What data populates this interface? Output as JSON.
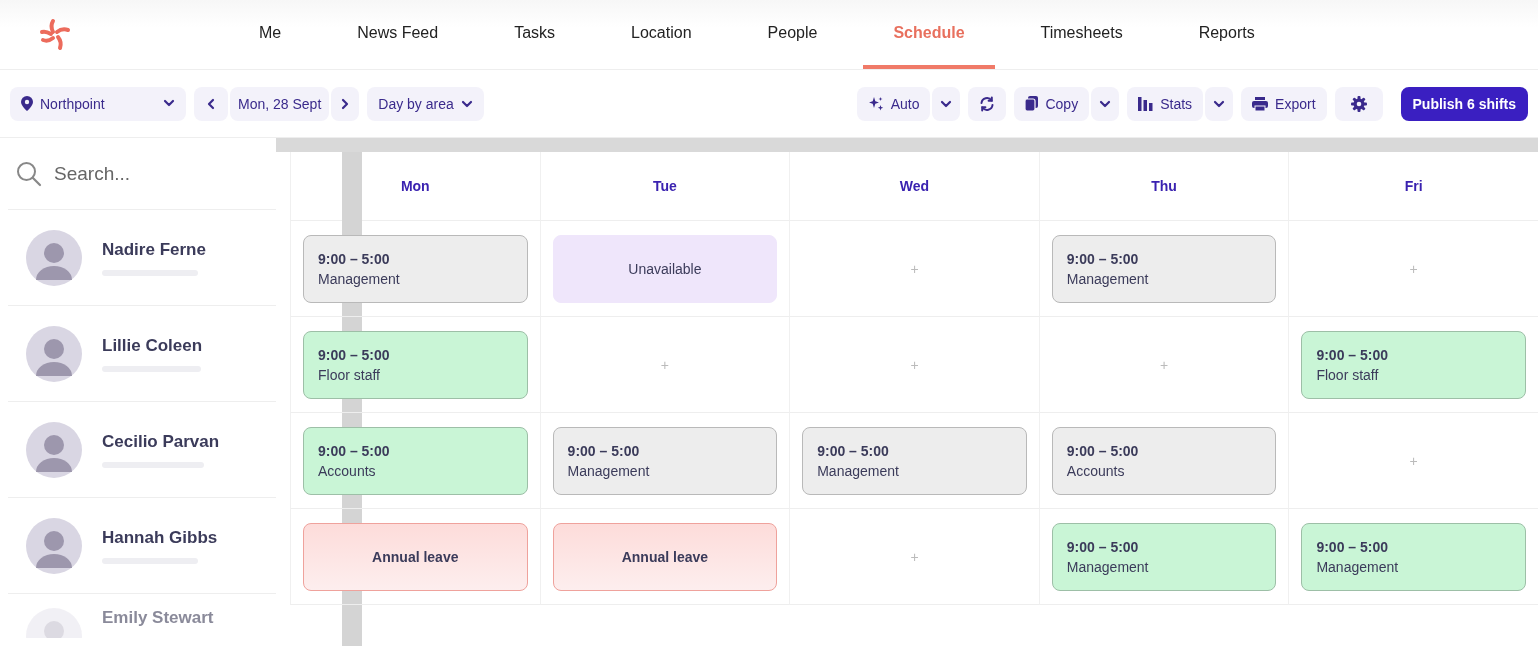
{
  "nav": [
    {
      "label": "Me",
      "selected": false
    },
    {
      "label": "News Feed",
      "selected": false
    },
    {
      "label": "Tasks",
      "selected": false
    },
    {
      "label": "Location",
      "selected": false
    },
    {
      "label": "People",
      "selected": false
    },
    {
      "label": "Schedule",
      "selected": true
    },
    {
      "label": "Timesheets",
      "selected": false
    },
    {
      "label": "Reports",
      "selected": false
    }
  ],
  "toolbar": {
    "location": "Northpoint",
    "date": "Mon, 28 Sept",
    "view": "Day by area",
    "auto": "Auto",
    "copy": "Copy",
    "stats": "Stats",
    "export": "Export",
    "publish": "Publish 6 shifts"
  },
  "search": {
    "placeholder": "Search..."
  },
  "days": [
    "Mon",
    "Tue",
    "Wed",
    "Thu",
    "Fri"
  ],
  "staff": [
    {
      "name": "Nadire Ferne",
      "faded": false,
      "shifts": [
        {
          "kind": "shift",
          "time": "9:00 – 5:00",
          "role": "Management",
          "color": "#ededed"
        },
        {
          "kind": "unavailable",
          "label": "Unavailable"
        },
        {
          "kind": "empty",
          "label": "+"
        },
        {
          "kind": "shift",
          "time": "9:00 – 5:00",
          "role": "Management",
          "color": "#ededed"
        },
        {
          "kind": "empty",
          "label": "+"
        }
      ]
    },
    {
      "name": "Lillie Coleen",
      "faded": false,
      "shifts": [
        {
          "kind": "shift",
          "time": "9:00 – 5:00",
          "role": "Floor staff",
          "color": "#c9f5d6"
        },
        {
          "kind": "empty",
          "label": "+"
        },
        {
          "kind": "empty",
          "label": "+"
        },
        {
          "kind": "empty",
          "label": "+"
        },
        {
          "kind": "shift",
          "time": "9:00 – 5:00",
          "role": "Floor staff",
          "color": "#c9f5d6"
        }
      ]
    },
    {
      "name": "Cecilio Parvan",
      "faded": false,
      "shifts": [
        {
          "kind": "shift",
          "time": "9:00 – 5:00",
          "role": "Accounts",
          "color": "#c9f5d6"
        },
        {
          "kind": "shift",
          "time": "9:00 – 5:00",
          "role": "Management",
          "color": "#ededed"
        },
        {
          "kind": "shift",
          "time": "9:00 – 5:00",
          "role": "Management",
          "color": "#ededed"
        },
        {
          "kind": "shift",
          "time": "9:00 – 5:00",
          "role": "Accounts",
          "color": "#ededed"
        },
        {
          "kind": "empty",
          "label": "+"
        }
      ]
    },
    {
      "name": "Hannah Gibbs",
      "faded": false,
      "shifts": [
        {
          "kind": "leave",
          "label": "Annual leave"
        },
        {
          "kind": "leave",
          "label": "Annual leave"
        },
        {
          "kind": "empty",
          "label": "+"
        },
        {
          "kind": "shift",
          "time": "9:00 – 5:00",
          "role": "Management",
          "color": "#c9f5d6"
        },
        {
          "kind": "shift",
          "time": "9:00 – 5:00",
          "role": "Management",
          "color": "#c9f5d6"
        }
      ]
    },
    {
      "name": "Emily Stewart",
      "faded": true
    }
  ]
}
